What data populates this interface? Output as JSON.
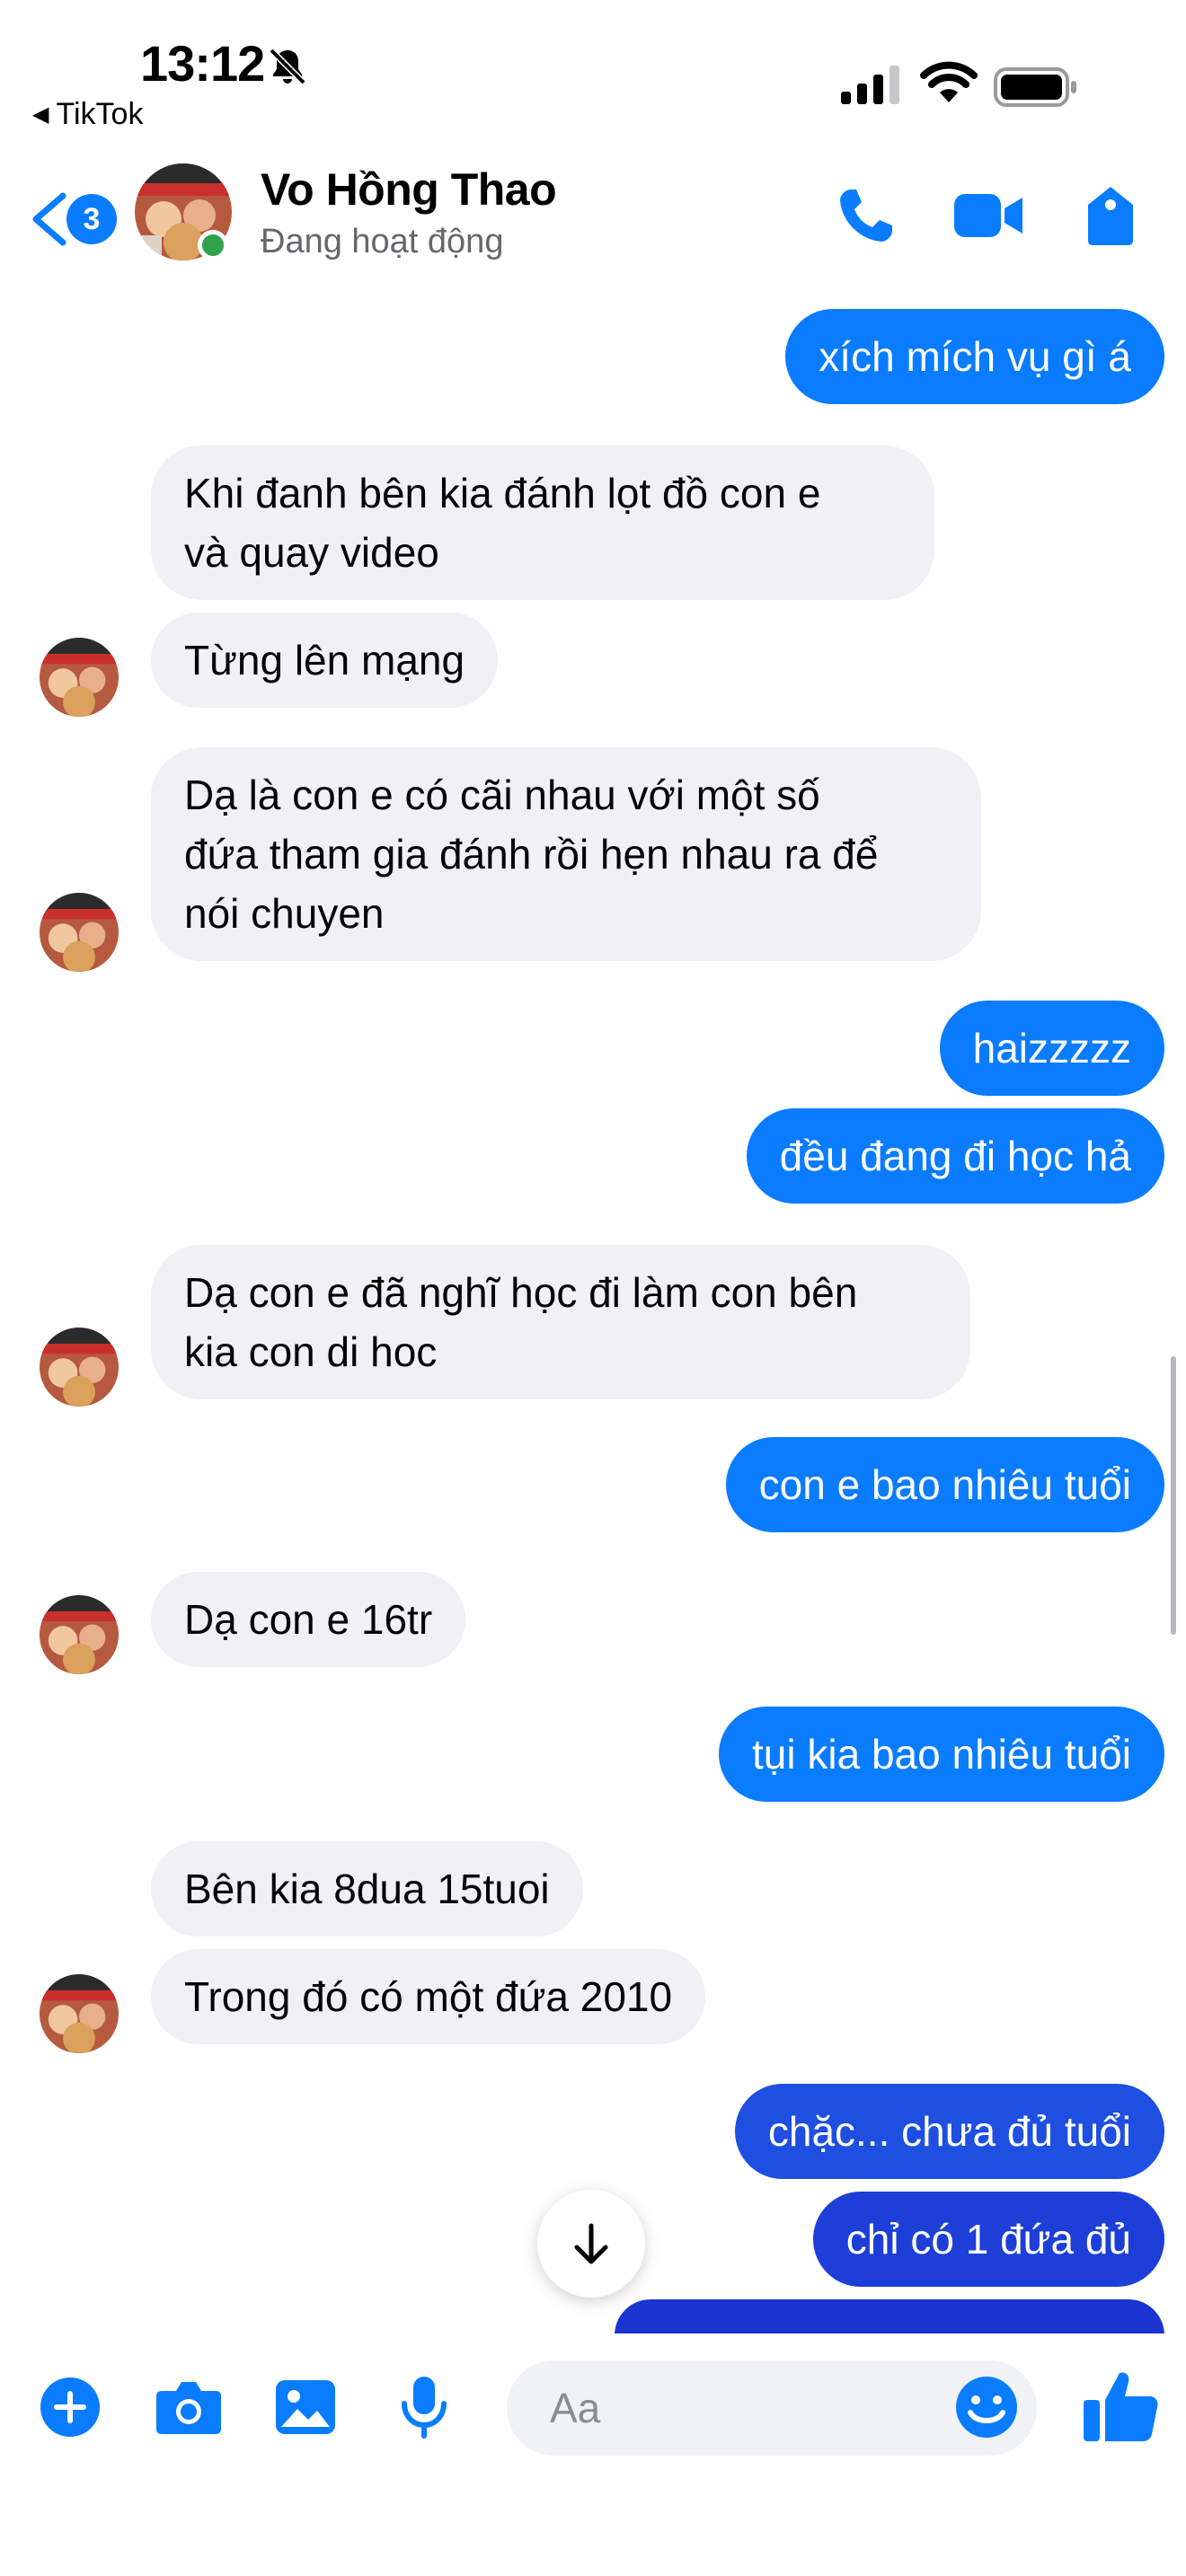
{
  "status_bar": {
    "time": "13:12",
    "back_app_label": "TikTok"
  },
  "header": {
    "unread_count": "3",
    "contact_name": "Vo Hồng Thao",
    "contact_status": "Đang hoạt động",
    "accent_color": "#0a7cff",
    "icons": [
      "phone-icon",
      "video-camera-icon",
      "tag-icon"
    ]
  },
  "messages": [
    {
      "from": "me",
      "text": "xích mích vụ gì á"
    },
    {
      "from": "them",
      "text": "Khi đanh bên kia đánh lọt đồ con e\nvà quay video"
    },
    {
      "from": "them",
      "text": "Từng lên mạng"
    },
    {
      "from": "them",
      "text": "Dạ là con e có cãi nhau với một số\nđứa tham gia đánh rồi hẹn nhau ra để\nnói chuyen"
    },
    {
      "from": "me",
      "text": "haizzzzz"
    },
    {
      "from": "me",
      "text": "đều đang đi học hả"
    },
    {
      "from": "them",
      "text": "Dạ con e đã nghĩ học đi làm con bên\nkia con di hoc"
    },
    {
      "from": "me",
      "text": "con e bao nhiêu tuổi"
    },
    {
      "from": "them",
      "text": "Dạ con e 16tr"
    },
    {
      "from": "me",
      "text": "tụi kia bao nhiêu tuổi"
    },
    {
      "from": "them",
      "text": "Bên kia 8dua 15tuoi"
    },
    {
      "from": "them",
      "text": "Trong đó có một đứa 2010"
    },
    {
      "from": "me",
      "text": "chặc... chưa đủ tuổi"
    },
    {
      "from": "me",
      "text": "chỉ có 1 đứa đủ"
    }
  ],
  "composer": {
    "placeholder": "Aa",
    "icons": [
      "plus-icon",
      "camera-icon",
      "image-icon",
      "microphone-icon",
      "emoji-icon",
      "thumbs-up-icon"
    ]
  },
  "colors": {
    "outgoing_bubble": "#0a7cff",
    "incoming_bubble": "#f0f0f5",
    "online": "#31a24c"
  }
}
